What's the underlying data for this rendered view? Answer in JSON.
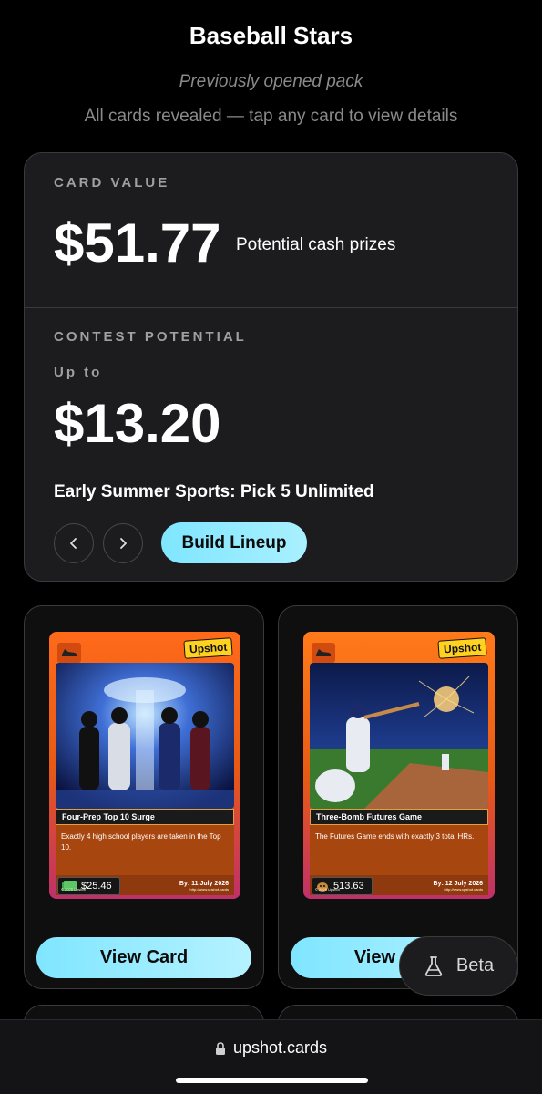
{
  "header": {
    "title": "Baseball Stars",
    "subtitle": "Previously opened pack",
    "hint": "All cards revealed — tap any card to view details"
  },
  "value_panel": {
    "card_value_label": "CARD VALUE",
    "card_value": "$51.77",
    "card_value_note": "Potential cash prizes",
    "contest_label": "CONTEST POTENTIAL",
    "upto_label": "Up to",
    "contest_value": "$13.20",
    "contest_name": "Early Summer Sports: Pick 5 Unlimited",
    "prev_icon": "chevron-left-icon",
    "next_icon": "chevron-right-icon",
    "build_label": "Build Lineup"
  },
  "cards": [
    {
      "brand": "Upshot",
      "name": "Four-Prep Top 10 Surge",
      "description": "Exactly 4 high school players are taken in the Top 10.",
      "price": "$25.46",
      "price_icon": "cash-icon",
      "date": "By: 11 July 2026",
      "footer_left": "© 2025 Upshot",
      "footer_right": "http://www.upshot.cards",
      "view_label": "View Card"
    },
    {
      "brand": "Upshot",
      "name": "Three-Bomb Futures Game",
      "description": "The Futures Game ends with exactly 3 total HRs.",
      "price": "513.63",
      "price_icon": "dog-icon",
      "date": "By: 12 July 2026",
      "footer_left": "© 2025 Upshot",
      "footer_right": "http://www.upshot.cards",
      "view_label": "View Card"
    }
  ],
  "beta": {
    "label": "Beta",
    "icon": "flask-icon"
  },
  "browser": {
    "url": "upshot.cards",
    "lock_icon": "lock-icon"
  },
  "colors": {
    "accent": "#7fe6ff",
    "panel": "#1c1c1e",
    "card_orange": "#ff6a1a"
  }
}
